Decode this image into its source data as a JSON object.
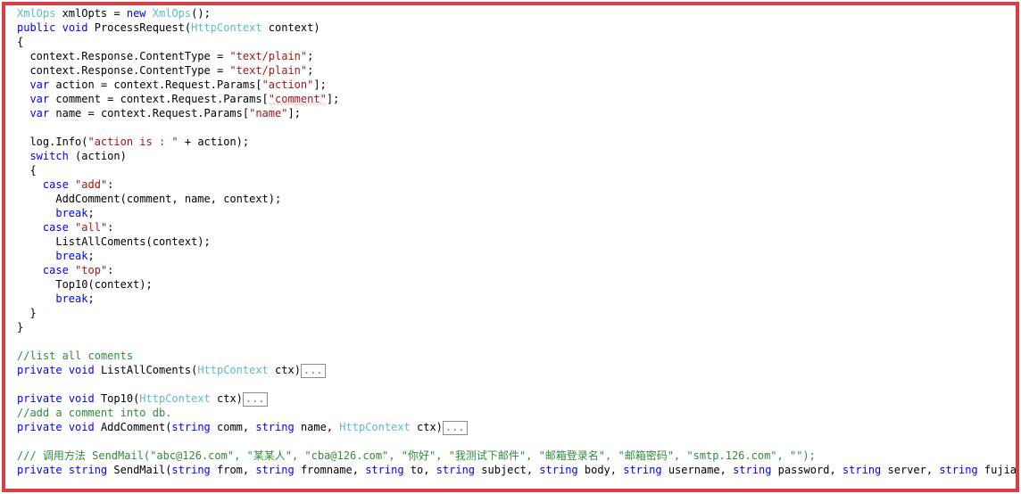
{
  "window": {
    "kind": "code-editor-snippet",
    "background_color": "#ffffff",
    "highlight_border_color": "#dc3c46"
  },
  "theme": {
    "plain_color": "#000000",
    "keyword_color": "#0000ff",
    "type_color": "#5bbcc4",
    "string_color": "#a31515",
    "comment_color": "#2e8b3c",
    "collapsed_box_border": "#8a8a8a",
    "collapsed_box_text_color": "#7a7a7a"
  },
  "editor": {
    "collapsed_marker": "...",
    "language": "C#",
    "lines": [
      {
        "n": 1,
        "tokens": [
          {
            "t": "type",
            "v": "XmlOps"
          },
          {
            "t": "plain",
            "v": " xmlOpts = "
          },
          {
            "t": "keyword",
            "v": "new"
          },
          {
            "t": "plain",
            "v": " "
          },
          {
            "t": "type",
            "v": "XmlOps"
          },
          {
            "t": "plain",
            "v": "();"
          }
        ]
      },
      {
        "n": 2,
        "tokens": [
          {
            "t": "keyword",
            "v": "public"
          },
          {
            "t": "plain",
            "v": " "
          },
          {
            "t": "keyword",
            "v": "void"
          },
          {
            "t": "plain",
            "v": " ProcessRequest("
          },
          {
            "t": "type",
            "v": "HttpContext"
          },
          {
            "t": "plain",
            "v": " context)"
          }
        ]
      },
      {
        "n": 3,
        "tokens": [
          {
            "t": "plain",
            "v": "{"
          }
        ]
      },
      {
        "n": 4,
        "tokens": [
          {
            "t": "plain",
            "v": "  context.Response.ContentType = "
          },
          {
            "t": "string",
            "v": "\"text/plain\""
          },
          {
            "t": "plain",
            "v": ";"
          }
        ]
      },
      {
        "n": 5,
        "tokens": [
          {
            "t": "plain",
            "v": "  context.Response.ContentType = "
          },
          {
            "t": "string",
            "v": "\"text/plain\""
          },
          {
            "t": "plain",
            "v": ";"
          }
        ]
      },
      {
        "n": 6,
        "tokens": [
          {
            "t": "plain",
            "v": "  "
          },
          {
            "t": "keyword",
            "v": "var"
          },
          {
            "t": "plain",
            "v": " action = context.Request.Params["
          },
          {
            "t": "string",
            "v": "\"action\""
          },
          {
            "t": "plain",
            "v": "];"
          }
        ]
      },
      {
        "n": 7,
        "tokens": [
          {
            "t": "plain",
            "v": "  "
          },
          {
            "t": "keyword",
            "v": "var"
          },
          {
            "t": "plain",
            "v": " comment = context.Request.Params["
          },
          {
            "t": "string-squiggle",
            "v": "\"comment\""
          },
          {
            "t": "plain",
            "v": "];"
          }
        ]
      },
      {
        "n": 8,
        "tokens": [
          {
            "t": "plain",
            "v": "  "
          },
          {
            "t": "keyword",
            "v": "var"
          },
          {
            "t": "plain",
            "v": " name = context.Request.Params["
          },
          {
            "t": "string",
            "v": "\"name\""
          },
          {
            "t": "plain",
            "v": "];"
          }
        ]
      },
      {
        "n": 9,
        "tokens": []
      },
      {
        "n": 10,
        "tokens": [
          {
            "t": "plain",
            "v": "  log.Info("
          },
          {
            "t": "string",
            "v": "\"action is : \""
          },
          {
            "t": "plain",
            "v": " + action);"
          }
        ]
      },
      {
        "n": 11,
        "tokens": [
          {
            "t": "plain",
            "v": "  "
          },
          {
            "t": "keyword",
            "v": "switch"
          },
          {
            "t": "plain",
            "v": " (action)"
          }
        ]
      },
      {
        "n": 12,
        "tokens": [
          {
            "t": "plain",
            "v": "  {"
          }
        ]
      },
      {
        "n": 13,
        "tokens": [
          {
            "t": "plain",
            "v": "    "
          },
          {
            "t": "keyword",
            "v": "case"
          },
          {
            "t": "plain",
            "v": " "
          },
          {
            "t": "string",
            "v": "\"add\""
          },
          {
            "t": "plain",
            "v": ":"
          }
        ]
      },
      {
        "n": 14,
        "tokens": [
          {
            "t": "plain",
            "v": "      AddComment(comment, name, context);"
          }
        ]
      },
      {
        "n": 15,
        "tokens": [
          {
            "t": "plain",
            "v": "      "
          },
          {
            "t": "keyword",
            "v": "break"
          },
          {
            "t": "plain",
            "v": ";"
          }
        ]
      },
      {
        "n": 16,
        "tokens": [
          {
            "t": "plain",
            "v": "    "
          },
          {
            "t": "keyword",
            "v": "case"
          },
          {
            "t": "plain",
            "v": " "
          },
          {
            "t": "string",
            "v": "\"all\""
          },
          {
            "t": "plain",
            "v": ":"
          }
        ]
      },
      {
        "n": 17,
        "tokens": [
          {
            "t": "plain",
            "v": "      ListAllComents(context);"
          }
        ]
      },
      {
        "n": 18,
        "tokens": [
          {
            "t": "plain",
            "v": "      "
          },
          {
            "t": "keyword",
            "v": "break"
          },
          {
            "t": "plain",
            "v": ";"
          }
        ]
      },
      {
        "n": 19,
        "tokens": [
          {
            "t": "plain",
            "v": "    "
          },
          {
            "t": "keyword",
            "v": "case"
          },
          {
            "t": "plain",
            "v": " "
          },
          {
            "t": "string",
            "v": "\"top\""
          },
          {
            "t": "plain",
            "v": ":"
          }
        ]
      },
      {
        "n": 20,
        "tokens": [
          {
            "t": "plain",
            "v": "      Top10(context);"
          }
        ]
      },
      {
        "n": 21,
        "tokens": [
          {
            "t": "plain",
            "v": "      "
          },
          {
            "t": "keyword",
            "v": "break"
          },
          {
            "t": "plain",
            "v": ";"
          }
        ]
      },
      {
        "n": 22,
        "tokens": [
          {
            "t": "plain",
            "v": "  }"
          }
        ]
      },
      {
        "n": 23,
        "tokens": [
          {
            "t": "plain",
            "v": "}"
          }
        ]
      },
      {
        "n": 24,
        "tokens": []
      },
      {
        "n": 25,
        "tokens": [
          {
            "t": "comment",
            "v": "//list all coments"
          }
        ]
      },
      {
        "n": 26,
        "tokens": [
          {
            "t": "keyword",
            "v": "private"
          },
          {
            "t": "plain",
            "v": " "
          },
          {
            "t": "keyword",
            "v": "void"
          },
          {
            "t": "plain",
            "v": " ListAllComents("
          },
          {
            "t": "type",
            "v": "HttpContext"
          },
          {
            "t": "plain",
            "v": " ctx)"
          },
          {
            "t": "collapsed",
            "v": "..."
          }
        ]
      },
      {
        "n": 27,
        "tokens": []
      },
      {
        "n": 28,
        "tokens": [
          {
            "t": "keyword",
            "v": "private"
          },
          {
            "t": "plain",
            "v": " "
          },
          {
            "t": "keyword",
            "v": "void"
          },
          {
            "t": "plain",
            "v": " Top10("
          },
          {
            "t": "type",
            "v": "HttpContext"
          },
          {
            "t": "plain",
            "v": " ctx)"
          },
          {
            "t": "collapsed",
            "v": "..."
          }
        ]
      },
      {
        "n": 29,
        "tokens": [
          {
            "t": "comment",
            "v": "//add a comment into db."
          }
        ]
      },
      {
        "n": 30,
        "tokens": [
          {
            "t": "keyword",
            "v": "private"
          },
          {
            "t": "plain",
            "v": " "
          },
          {
            "t": "keyword",
            "v": "void"
          },
          {
            "t": "plain",
            "v": " AddComment("
          },
          {
            "t": "keyword",
            "v": "string"
          },
          {
            "t": "plain",
            "v": " comm, "
          },
          {
            "t": "keyword",
            "v": "string"
          },
          {
            "t": "plain",
            "v": " name, "
          },
          {
            "t": "type",
            "v": "HttpContext"
          },
          {
            "t": "plain",
            "v": " ctx)"
          },
          {
            "t": "collapsed",
            "v": "..."
          }
        ]
      },
      {
        "n": 31,
        "tokens": []
      },
      {
        "n": 32,
        "tokens": [
          {
            "t": "comment",
            "v": "/// 调用方法 SendMail(\"abc@126.com\", \"某某人\", \"cba@126.com\", \"你好\", \"我测试下邮件\", \"邮箱登录名\", \"邮箱密码\", \"smtp.126.com\", \"\");"
          }
        ]
      },
      {
        "n": 33,
        "tokens": [
          {
            "t": "keyword",
            "v": "private"
          },
          {
            "t": "plain",
            "v": " "
          },
          {
            "t": "keyword",
            "v": "string"
          },
          {
            "t": "plain",
            "v": " SendMail("
          },
          {
            "t": "keyword",
            "v": "string"
          },
          {
            "t": "plain",
            "v": " from, "
          },
          {
            "t": "keyword",
            "v": "string"
          },
          {
            "t": "plain",
            "v": " fromname, "
          },
          {
            "t": "keyword",
            "v": "string"
          },
          {
            "t": "plain",
            "v": " to, "
          },
          {
            "t": "keyword",
            "v": "string"
          },
          {
            "t": "plain",
            "v": " subject, "
          },
          {
            "t": "keyword",
            "v": "string"
          },
          {
            "t": "plain",
            "v": " body, "
          },
          {
            "t": "keyword",
            "v": "string"
          },
          {
            "t": "plain",
            "v": " username, "
          },
          {
            "t": "keyword",
            "v": "string"
          },
          {
            "t": "plain",
            "v": " password, "
          },
          {
            "t": "keyword",
            "v": "string"
          },
          {
            "t": "plain",
            "v": " server, "
          },
          {
            "t": "keyword",
            "v": "string"
          },
          {
            "t": "plain",
            "v": " fujian)"
          },
          {
            "t": "collapsed",
            "v": "..."
          }
        ]
      }
    ]
  }
}
